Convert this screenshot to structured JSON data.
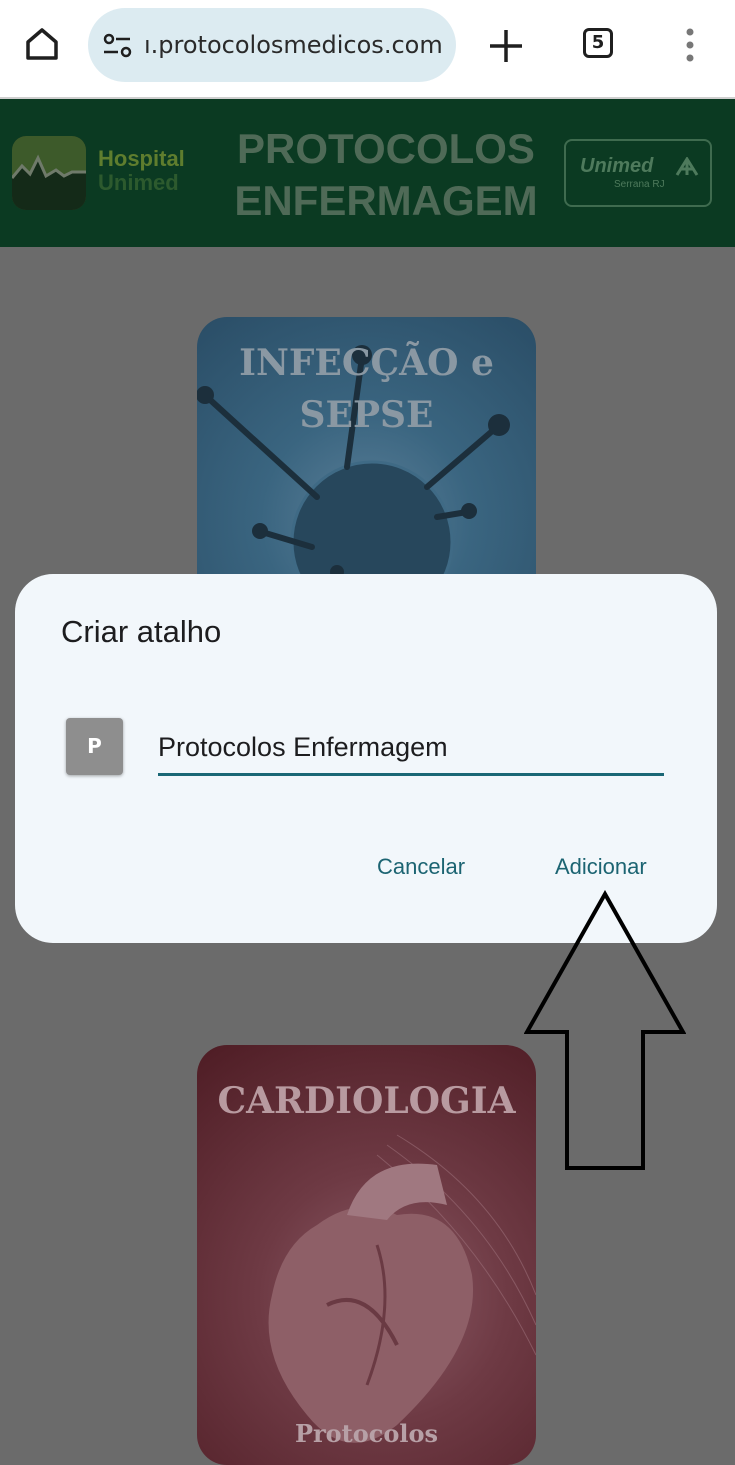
{
  "browser": {
    "url": "ı.protocolosmedicos.com",
    "tab_count": "5",
    "icons": {
      "home": "home-icon",
      "site_settings": "tune-icon",
      "new_tab": "plus-icon",
      "menu": "more-vert-icon"
    }
  },
  "site": {
    "hospital_logo": [
      "Hospital",
      "Unimed"
    ],
    "title_line1": "PROTOCOLOS",
    "title_line2": "ENFERMAGEM",
    "partner_logo": "Unimed",
    "partner_sub": "Serrana RJ"
  },
  "cards": [
    {
      "title_line1": "INFECÇÃO e",
      "title_line2": "SEPSE"
    },
    {
      "title": "CARDIOLOGIA",
      "subtitle": "Protocolos"
    }
  ],
  "dialog": {
    "title": "Criar atalho",
    "avatar_letter": "P",
    "name_value": "Protocolos Enfermagem",
    "cancel_label": "Cancelar",
    "add_label": "Adicionar"
  },
  "colors": {
    "dialog_bg": "#f2f7fb",
    "accent": "#1c6472",
    "header_bg": "#0b3a22",
    "scrim": "#6b6b6b"
  }
}
